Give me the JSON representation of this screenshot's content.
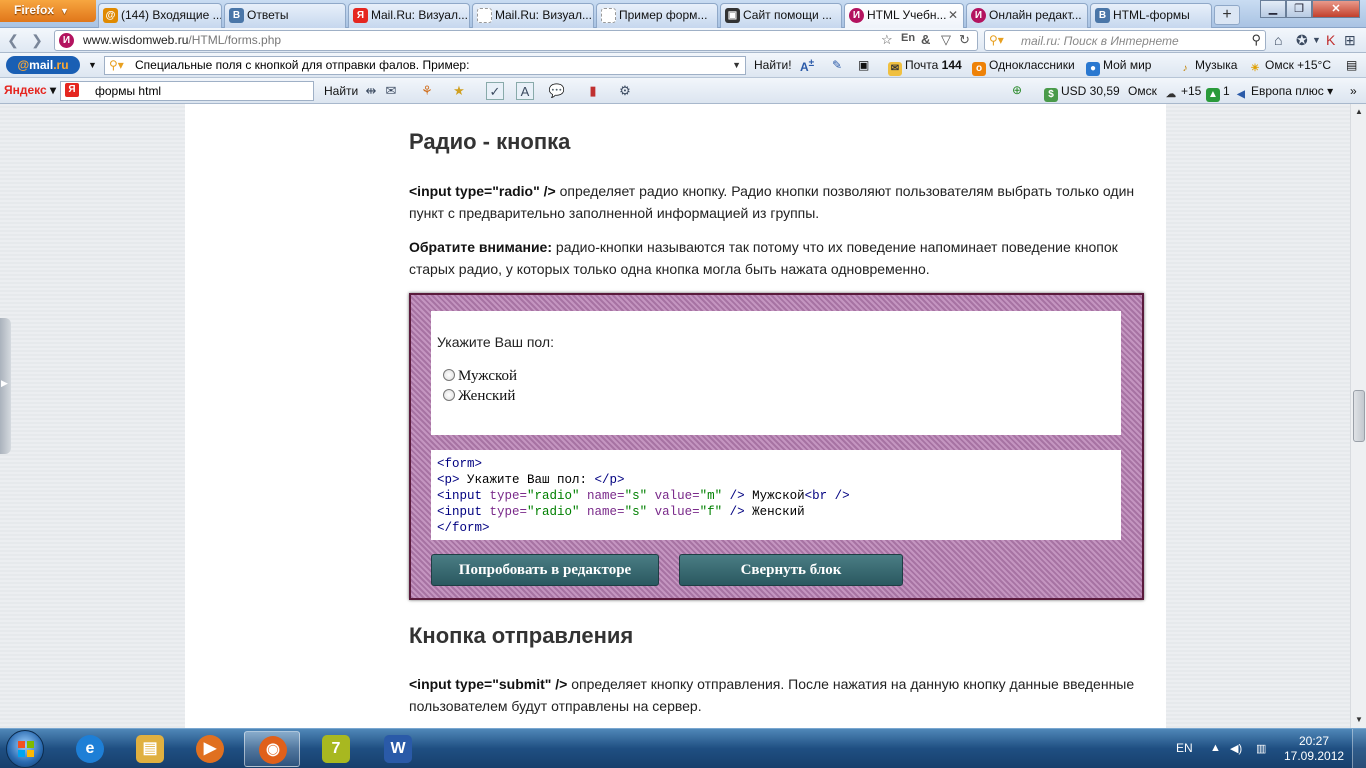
{
  "browser": {
    "menu_button": "Firefox",
    "tabs": [
      {
        "title": "(144) Входящие ...",
        "icon": "mail-icon",
        "color": "#e08a00"
      },
      {
        "title": "Ответы",
        "icon": "vk-icon",
        "color": "#4a76a8"
      },
      {
        "title": "Mail.Ru: Визуал...",
        "icon": "yandex-icon",
        "color": "#e52620"
      },
      {
        "title": "Mail.Ru: Визуал...",
        "icon": "blank-page-icon",
        "color": "#bbbbbb"
      },
      {
        "title": "Пример форм...",
        "icon": "blank-page-icon",
        "color": "#bbbbbb"
      },
      {
        "title": "Сайт помощи ...",
        "icon": "help-site-icon",
        "color": "#333333"
      },
      {
        "title": "HTML Учебн...",
        "icon": "wisdomweb-icon",
        "color": "#b3135f",
        "active": true
      },
      {
        "title": "Онлайн редакт...",
        "icon": "wisdomweb-icon",
        "color": "#b3135f"
      },
      {
        "title": "HTML-формы",
        "icon": "vk-icon",
        "color": "#4a76a8"
      }
    ],
    "new_tab": "+",
    "url_host": "www.wisdomweb.ru",
    "url_path": "/HTML/forms.php",
    "search_placeholder": "mail.ru: Поиск в Интернете"
  },
  "mailru_toolbar": {
    "logo_at": "@",
    "logo_mail": "mail",
    "logo_ru": ".ru",
    "search_value": "Специальные поля с кнопкой для отправки фалов. Пример:",
    "find_label": "Найти!",
    "mail_label": "Почта",
    "mail_count": "144",
    "ok_label": "Одноклассники",
    "myworld_label": "Мой мир",
    "music_label": "Музыка",
    "weather_label": "Омск +15°C"
  },
  "yandex_toolbar": {
    "logo_ya": "Я",
    "logo_rest": "ндекс",
    "search_value": "формы html",
    "find_label": "Найти",
    "usd_label": "USD 30,59",
    "city_label": "Омск",
    "temp_label": "+15",
    "count_label": "1",
    "radio_label": "Европа плюс"
  },
  "page": {
    "radio_heading": "Радио - кнопка",
    "radio_p1_code": "<input type=\"radio\" />",
    "radio_p1_text": " определяет радио кнопку. Радио кнопки позволяют пользователям выбрать только один пункт с предварительно заполненной информацией из группы.",
    "radio_p2_bold": "Обратите внимание:",
    "radio_p2_text": " радио-кнопки называются так потому что их поведение напоминает поведение кнопок старых радио, у которых только одна кнопка могла быть нажата одновременно.",
    "demo": {
      "prompt": "Укажите Ваш пол:",
      "options": [
        "Мужской",
        "Женский"
      ],
      "code": {
        "l1": "<form>",
        "l2_open": "<p>",
        "l2_text": " Укажите Ваш пол: ",
        "l2_close": "</p>",
        "l3_tag": "<input",
        "l3_attr1": " type=",
        "l3_val1": "\"radio\"",
        "l3_attr2": " name=",
        "l3_val2": "\"s\"",
        "l3_attr3": " value=",
        "l3_val3": "\"m\"",
        "l3_end": " />",
        "l3_text": " Мужской",
        "l3_br": "<br />",
        "l4_tag": "<input",
        "l4_attr1": " type=",
        "l4_val1": "\"radio\"",
        "l4_attr2": " name=",
        "l4_val2": "\"s\"",
        "l4_attr3": " value=",
        "l4_val3": "\"f\"",
        "l4_end": " />",
        "l4_text": " Женский",
        "l5": "</form>"
      },
      "try_button": "Попробовать в редакторе",
      "collapse_button": "Свернуть блок"
    },
    "submit_heading": "Кнопка отправления",
    "submit_p_code": "<input type=\"submit\" />",
    "submit_p_text": " определяет кнопку отправления. После нажатия на данную кнопку данные введенные пользователем будут отправлены на сервер."
  },
  "taskbar": {
    "apps": [
      {
        "name": "internet-explorer-icon",
        "label": "e",
        "color": "#1e7fd6"
      },
      {
        "name": "explorer-folder-icon",
        "label": "▤",
        "color": "#e0b040"
      },
      {
        "name": "media-player-icon",
        "label": "▶",
        "color": "#e07020"
      },
      {
        "name": "firefox-icon",
        "label": "◉",
        "color": "#e0601a",
        "active": true
      },
      {
        "name": "seven-zip-icon",
        "label": "7",
        "color": "#a8b820"
      },
      {
        "name": "word-icon",
        "label": "W",
        "color": "#2a5aa8"
      }
    ],
    "lang": "EN",
    "time": "20:27",
    "date": "17.09.2012"
  }
}
